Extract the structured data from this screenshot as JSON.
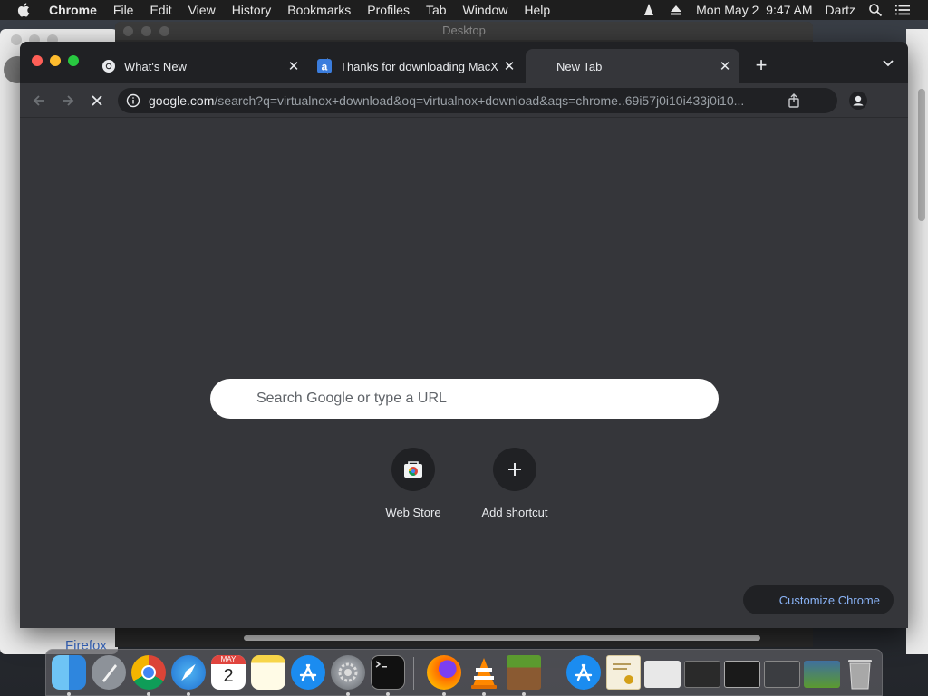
{
  "menubar": {
    "app_name": "Chrome",
    "items": [
      "File",
      "Edit",
      "View",
      "History",
      "Bookmarks",
      "Profiles",
      "Tab",
      "Window",
      "Help"
    ],
    "datetime": "Mon May 2  9:47 AM",
    "user": "Dartz"
  },
  "background_window": {
    "title": "Desktop"
  },
  "behind_window": {
    "text": "Firefox"
  },
  "chrome": {
    "tabs": [
      {
        "label": "What's New",
        "icon": "chrome-icon",
        "active": false
      },
      {
        "label": "Thanks for downloading MacX",
        "icon": "macx-icon",
        "active": false
      },
      {
        "label": "New Tab",
        "icon": "",
        "active": true
      }
    ],
    "omnibox": {
      "host": "google.com",
      "path": "/search?q=virtualnox+download&oq=virtualnox+download&aqs=chrome..69i57j0i10i433j0i10..."
    },
    "ntp": {
      "search_placeholder": "Search Google or type a URL",
      "shortcuts": [
        {
          "label": "Web Store",
          "icon": "web-store-icon"
        },
        {
          "label": "Add shortcut",
          "icon": "plus-icon"
        }
      ],
      "customize_label": "Customize Chrome"
    }
  },
  "dock": {
    "apps": [
      "Finder",
      "Launchpad",
      "Chrome",
      "Safari",
      "Calendar",
      "Notes",
      "App Store",
      "System Preferences",
      "Terminal",
      "Firefox",
      "VLC",
      "Minecraft",
      "App Store",
      "Certificate",
      "Preview",
      "Window",
      "Window",
      "Window",
      "Minecraft",
      "Trash"
    ],
    "calendar_month": "MAY",
    "calendar_day": "2"
  },
  "colors": {
    "tabstrip": "#202124",
    "toolbar": "#35363a",
    "link_blue": "#8ab4f8"
  }
}
